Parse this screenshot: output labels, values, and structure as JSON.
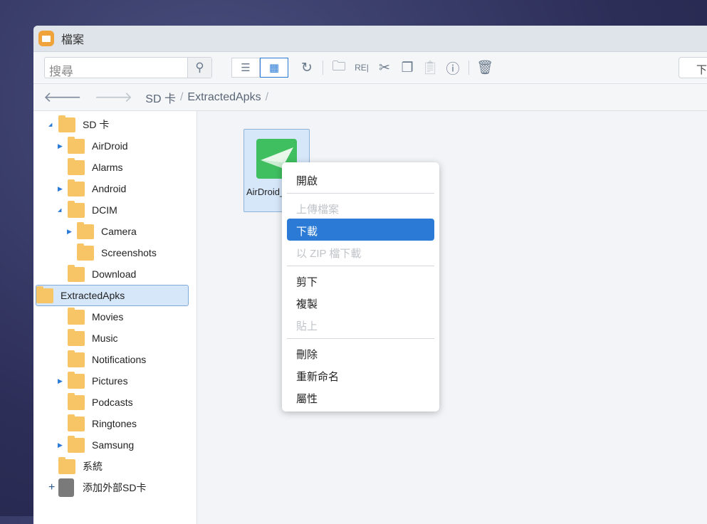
{
  "window": {
    "title": "檔案"
  },
  "toolbar": {
    "search_placeholder": "搜尋",
    "download_label": "下載"
  },
  "breadcrumb": {
    "items": [
      "SD 卡",
      "ExtractedApks"
    ]
  },
  "tree": [
    {
      "label": "SD 卡",
      "level": 0,
      "expanded": true
    },
    {
      "label": "AirDroid",
      "level": 1,
      "arrow": "collapsed"
    },
    {
      "label": "Alarms",
      "level": 1
    },
    {
      "label": "Android",
      "level": 1,
      "arrow": "collapsed"
    },
    {
      "label": "DCIM",
      "level": 1,
      "arrow": "expanded"
    },
    {
      "label": "Camera",
      "level": 2,
      "arrow": "collapsed"
    },
    {
      "label": "Screenshots",
      "level": 2
    },
    {
      "label": "Download",
      "level": 1
    },
    {
      "label": "ExtractedApks",
      "level": 1,
      "arrow": "collapsed",
      "selected": true
    },
    {
      "label": "Movies",
      "level": 1
    },
    {
      "label": "Music",
      "level": 1
    },
    {
      "label": "Notifications",
      "level": 1
    },
    {
      "label": "Pictures",
      "level": 1,
      "arrow": "collapsed"
    },
    {
      "label": "Podcasts",
      "level": 1
    },
    {
      "label": "Ringtones",
      "level": 1
    },
    {
      "label": "Samsung",
      "level": 1,
      "arrow": "collapsed"
    },
    {
      "label": "系統",
      "level": 0
    },
    {
      "label": "添加外部SD卡",
      "level": 0,
      "add": true
    }
  ],
  "files": [
    {
      "name": "AirDroid_",
      "icon": "airdroid-apk-icon"
    }
  ],
  "context_menu": [
    {
      "label": "開啟"
    },
    {
      "sep": true
    },
    {
      "label": "上傳檔案",
      "disabled": true
    },
    {
      "label": "下載",
      "highlighted": true
    },
    {
      "label": "以 ZIP 檔下載",
      "disabled": true
    },
    {
      "sep": true
    },
    {
      "label": "剪下"
    },
    {
      "label": "複製"
    },
    {
      "label": "貼上",
      "disabled": true
    },
    {
      "sep": true
    },
    {
      "label": "刪除"
    },
    {
      "label": "重新命名"
    },
    {
      "label": "屬性"
    }
  ],
  "colors": {
    "accent": "#2b7bd6",
    "folder": "#f7c566",
    "selection": "#d6e7fa"
  }
}
